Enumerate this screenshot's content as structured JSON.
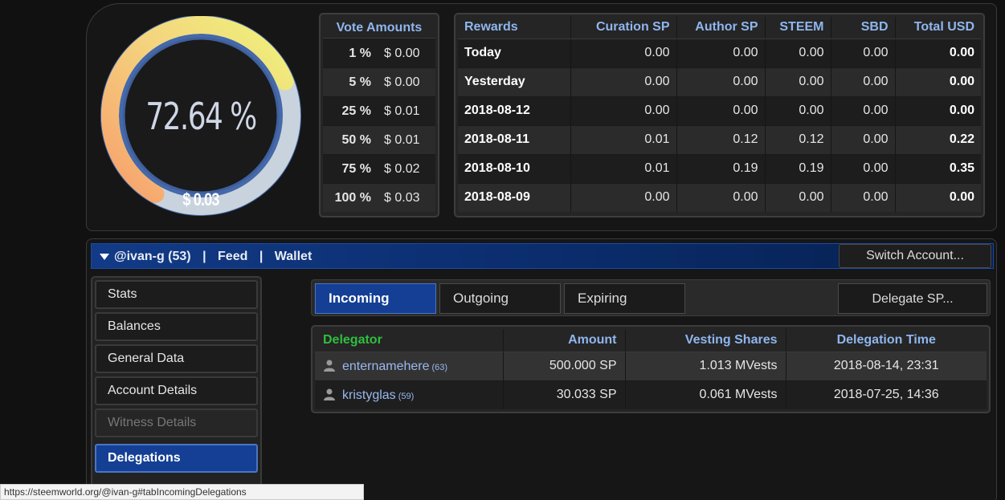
{
  "gauge": {
    "percent_label": "72.64 %",
    "value_label": "$ 0.03",
    "level": 0.7264,
    "colors": {
      "start": "#f8a26a",
      "mid": "#f6e07a",
      "end": "#e7f27a",
      "track": "#c9d3de",
      "ring": "#4a6aa8"
    }
  },
  "vote_amounts": {
    "header": "Vote Amounts",
    "rows": [
      {
        "pct": "1 %",
        "usd": "$ 0.00"
      },
      {
        "pct": "5 %",
        "usd": "$ 0.00"
      },
      {
        "pct": "25 %",
        "usd": "$ 0.01"
      },
      {
        "pct": "50 %",
        "usd": "$ 0.01"
      },
      {
        "pct": "75 %",
        "usd": "$ 0.02"
      },
      {
        "pct": "100 %",
        "usd": "$ 0.03"
      }
    ]
  },
  "rewards": {
    "headers": [
      "Rewards",
      "Curation SP",
      "Author SP",
      "STEEM",
      "SBD",
      "Total USD"
    ],
    "rows": [
      [
        "Today",
        "0.00",
        "0.00",
        "0.00",
        "0.00",
        "0.00"
      ],
      [
        "Yesterday",
        "0.00",
        "0.00",
        "0.00",
        "0.00",
        "0.00"
      ],
      [
        "2018-08-12",
        "0.00",
        "0.00",
        "0.00",
        "0.00",
        "0.00"
      ],
      [
        "2018-08-11",
        "0.01",
        "0.12",
        "0.12",
        "0.00",
        "0.22"
      ],
      [
        "2018-08-10",
        "0.01",
        "0.19",
        "0.19",
        "0.00",
        "0.35"
      ],
      [
        "2018-08-09",
        "0.00",
        "0.00",
        "0.00",
        "0.00",
        "0.00"
      ]
    ]
  },
  "nav": {
    "account": "@ivan-g (53)",
    "feed": "Feed",
    "wallet": "Wallet",
    "separator": "|",
    "switch_label": "Switch Account..."
  },
  "side_menu": {
    "items": [
      "Stats",
      "Balances",
      "General Data",
      "Account Details",
      "Witness Details",
      "Delegations"
    ]
  },
  "tabs": {
    "incoming": "Incoming",
    "outgoing": "Outgoing",
    "expiring": "Expiring",
    "delegate_label": "Delegate SP..."
  },
  "delegations": {
    "headers": [
      "Delegator",
      "Amount",
      "Vesting Shares",
      "Delegation Time"
    ],
    "rows": [
      {
        "name": "enternamehere",
        "rep": "(63)",
        "amount": "500.000 SP",
        "vests": "1.013 MVests",
        "time": "2018-08-14, 23:31"
      },
      {
        "name": "kristyglas",
        "rep": "(59)",
        "amount": "30.033 SP",
        "vests": "0.061 MVests",
        "time": "2018-07-25, 14:36"
      }
    ]
  },
  "status_bar": {
    "url": "https://steemworld.org/@ivan-g#tabIncomingDelegations"
  }
}
